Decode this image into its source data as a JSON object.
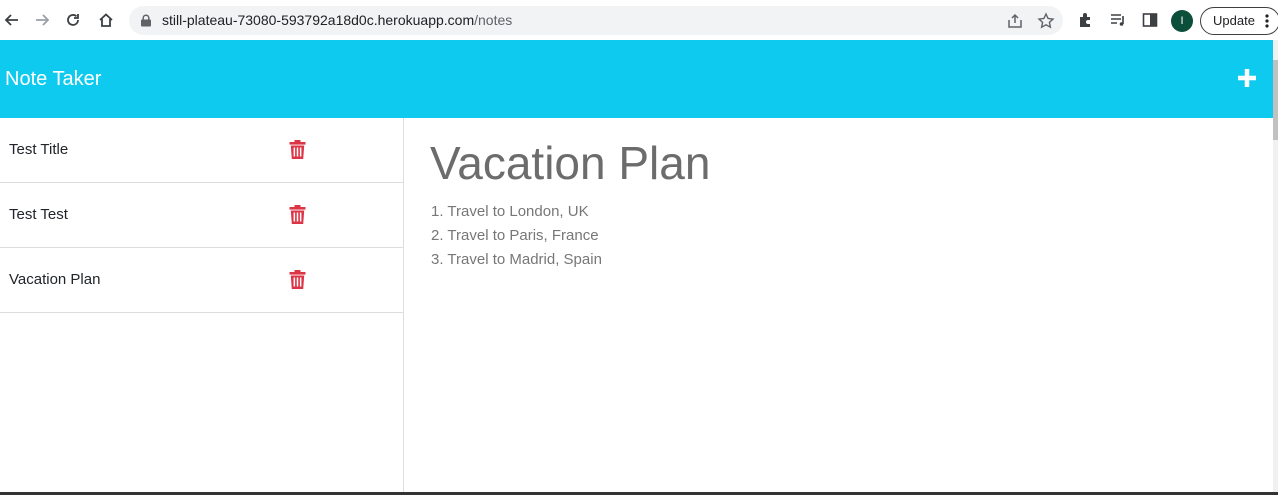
{
  "browser": {
    "url_host": "still-plateau-73080-593792a18d0c.herokuapp.com",
    "url_path": "/notes",
    "avatar_letter": "I",
    "update_label": "Update"
  },
  "app": {
    "title": "Note Taker",
    "accent_color": "#0ecaef",
    "delete_color": "#dc3545"
  },
  "notes": [
    {
      "title": "Test Title"
    },
    {
      "title": "Test Test"
    },
    {
      "title": "Vacation Plan"
    }
  ],
  "active_note": {
    "title": "Vacation Plan",
    "lines": [
      "1. Travel to London, UK",
      "2. Travel to Paris, France",
      "3. Travel to Madrid, Spain"
    ]
  }
}
